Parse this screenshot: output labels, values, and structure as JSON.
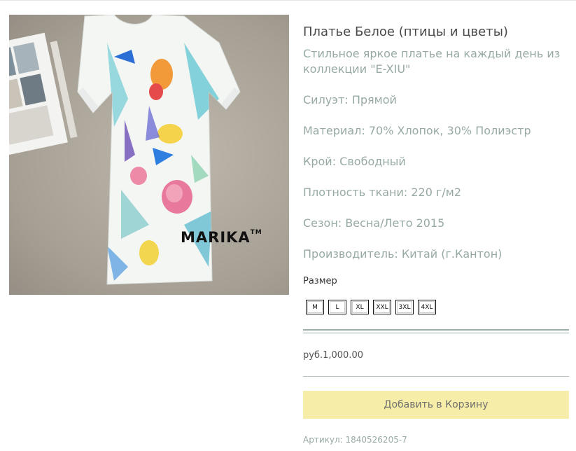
{
  "product": {
    "title": "Платье Белое (птицы и цветы)",
    "image_watermark": "MARIKA",
    "image_watermark_mark": "TM",
    "description": [
      "Стильное яркое платье на каждый день из",
      "коллекции \"E-XIU\"",
      "Силуэт: Прямой",
      "Материал: 70% Хлопок, 30% Полиэстр",
      "Крой: Свободный",
      "Плотность ткани: 220 г/м2",
      "Сезон: Весна/Лето 2015",
      "Производитель: Китай (г.Кантон)"
    ],
    "size_label": "Размер",
    "sizes": [
      "M",
      "L",
      "XL",
      "XXL",
      "3XL",
      "4XL"
    ],
    "price": "руб.1,000.00",
    "add_to_cart_label": "Добавить в Корзину",
    "sku": "Артикул: 1840526205-7"
  },
  "colors": {
    "description_text": "#97aaa2",
    "cart_button_bg": "#f6eda8",
    "divider": "#9ab0a6"
  }
}
